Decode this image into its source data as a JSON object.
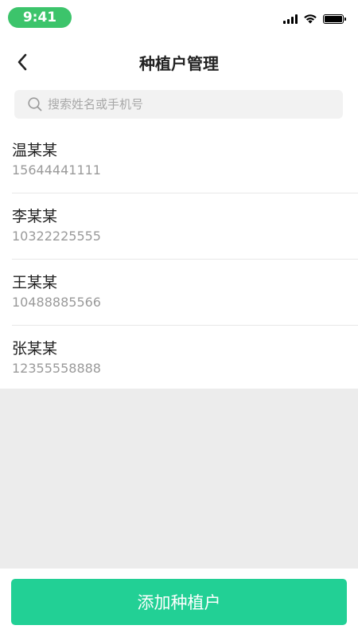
{
  "status_bar": {
    "time": "9:41",
    "icons": [
      "signal-icon",
      "wifi-icon",
      "battery-icon"
    ],
    "time_pill_color": "#3cc46b"
  },
  "nav": {
    "title": "种植户管理",
    "back_icon": "chevron-left-icon"
  },
  "search": {
    "placeholder": "搜索姓名或手机号",
    "value": "",
    "icon": "search-icon"
  },
  "farmers": [
    {
      "name": "温某某",
      "phone": "15644441111"
    },
    {
      "name": "李某某",
      "phone": "10322225555"
    },
    {
      "name": "王某某",
      "phone": "10488885566"
    },
    {
      "name": "张某某",
      "phone": "12355558888"
    }
  ],
  "footer": {
    "add_label": "添加种植户",
    "accent_color": "#22d095"
  }
}
